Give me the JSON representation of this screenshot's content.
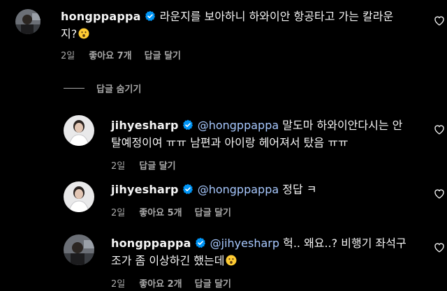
{
  "comments": [
    {
      "username": "hongppappa",
      "mention": "",
      "text_line1": "라운지를 보아하니 하와이안 항공타고 가는 칼라운",
      "text_line2": "지?",
      "time": "2일",
      "likes": "좋아요 7개",
      "reply": "답글 달기"
    },
    {
      "username": "jihyesharp",
      "mention": "@hongppappa",
      "text_line1": "말도마 하와이안다시는 안",
      "text_line2": "탈예정이여 ㅠㅠ 남편과 아이랑 헤어져서 탔음 ㅠㅠ",
      "time": "2일",
      "likes": "",
      "reply": "답글 달기"
    },
    {
      "username": "jihyesharp",
      "mention": "@hongppappa",
      "text_line1": "정답 ㅋ",
      "text_line2": "",
      "time": "2일",
      "likes": "좋아요 5개",
      "reply": "답글 달기"
    },
    {
      "username": "hongppappa",
      "mention": "@jihyesharp",
      "text_line1": "헉.. 왜요..? 비행기 좌석구",
      "text_line2": "조가 좀 이상하긴 했는데",
      "time": "2일",
      "likes": "좋아요 2개",
      "reply": "답글 달기"
    }
  ],
  "hide_replies_label": "답글 숨기기",
  "colors": {
    "background": "#000000",
    "text": "#f5f5f5",
    "secondary": "#a8a8a8",
    "mention": "#a8c9ff",
    "verified": "#0095f6"
  }
}
